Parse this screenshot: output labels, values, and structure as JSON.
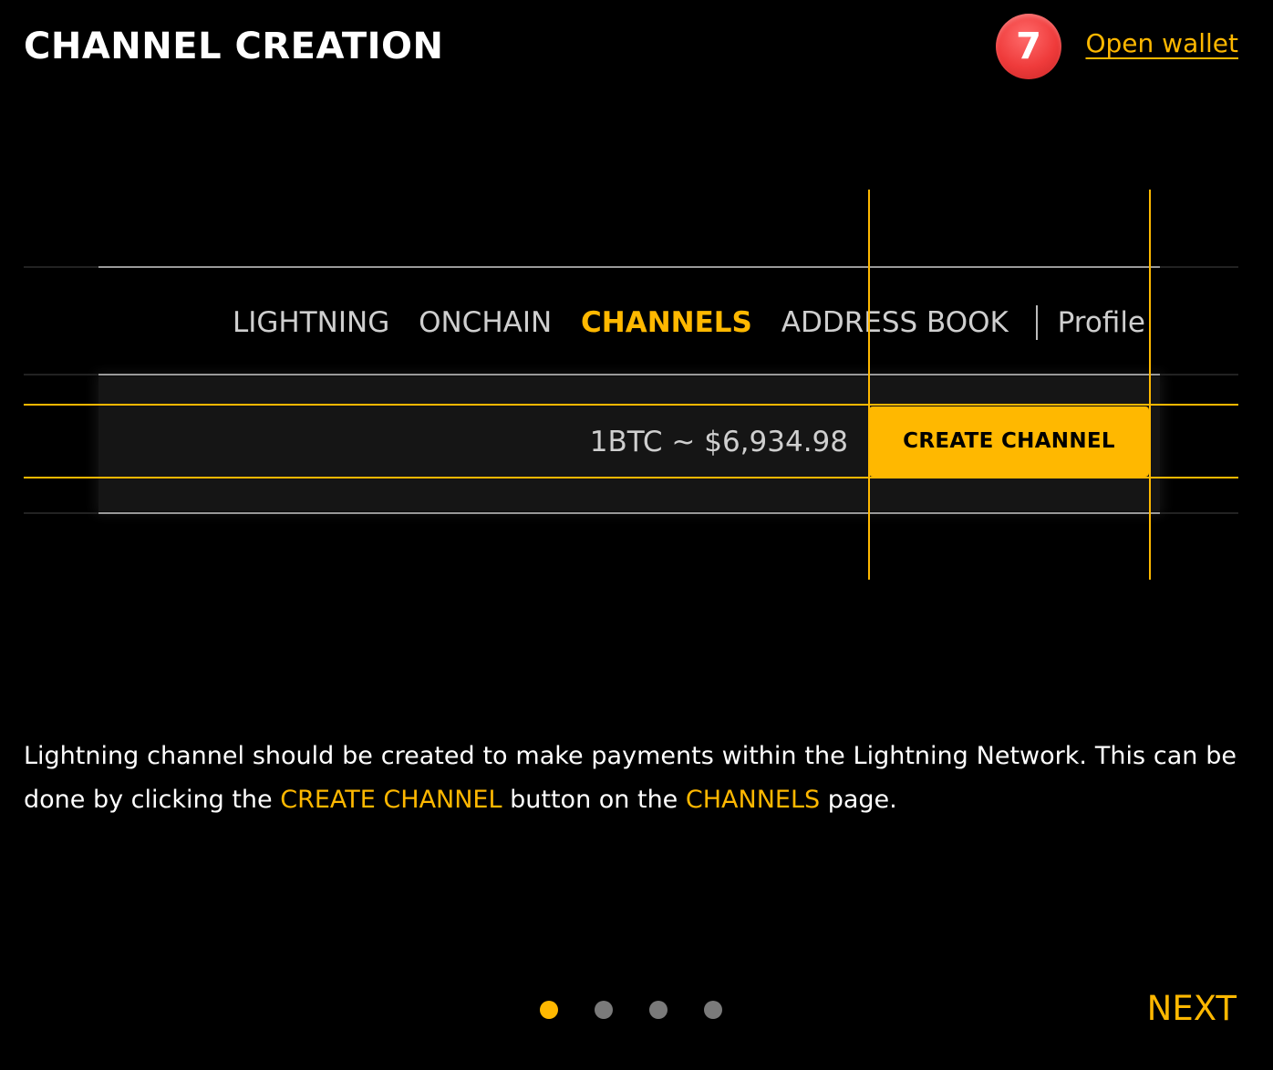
{
  "header": {
    "title": "CHANNEL CREATION",
    "step_badge": "7",
    "open_wallet_label": "Open wallet"
  },
  "illustration": {
    "nav_items": [
      "LIGHTNING",
      "ONCHAIN",
      "CHANNELS",
      "ADDRESS BOOK"
    ],
    "active_nav": "CHANNELS",
    "profile_label": "Profile",
    "price_text": "1BTC ~ $6,934.98",
    "create_channel_label": "CREATE CHANNEL"
  },
  "description": {
    "part1": "Lightning channel should be created to make payments within the Lightning Network. This can be done by clicking the ",
    "highlight1": "CREATE CHANNEL",
    "part2": " button on the ",
    "highlight2": "CHANNELS",
    "part3": " page."
  },
  "pagination": {
    "total": 4,
    "current": 1
  },
  "footer": {
    "next_label": "NEXT"
  },
  "colors": {
    "accent": "#ffb800",
    "background": "#000000",
    "badge": "#ef3b3b"
  }
}
